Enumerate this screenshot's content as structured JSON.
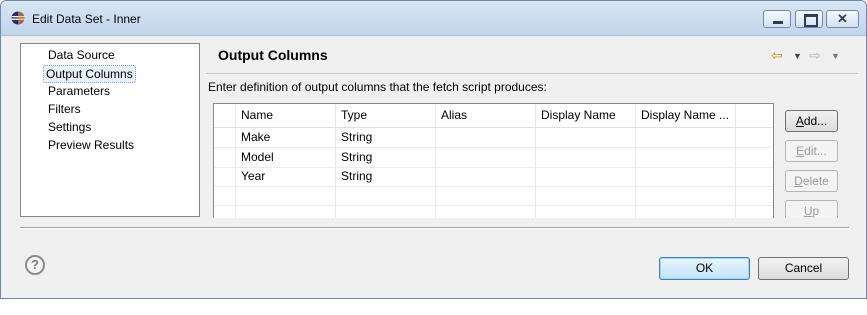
{
  "window": {
    "title": "Edit Data Set - Inner",
    "minimize_glyph": "",
    "close_glyph": "✕"
  },
  "nav": {
    "items": [
      {
        "label": "Data Source"
      },
      {
        "label": "Output Columns",
        "selected": true
      },
      {
        "label": "Parameters"
      },
      {
        "label": "Filters"
      },
      {
        "label": "Settings"
      },
      {
        "label": "Preview Results"
      }
    ]
  },
  "page": {
    "title": "Output Columns",
    "back_glyph": "⇦",
    "forward_glyph": "⇨",
    "dropdown_glyph": "▼",
    "instructions": "Enter definition of output columns that the fetch script produces:"
  },
  "table": {
    "columns": [
      "Name",
      "Type",
      "Alias",
      "Display Name",
      "Display Name ..."
    ],
    "rows": [
      [
        "Make",
        "String",
        "",
        "",
        ""
      ],
      [
        "Model",
        "String",
        "",
        "",
        ""
      ],
      [
        "Year",
        "String",
        "",
        "",
        ""
      ],
      [
        "",
        "",
        "",
        "",
        ""
      ],
      [
        "",
        "",
        "",
        "",
        ""
      ]
    ]
  },
  "side_buttons": {
    "add": {
      "prefix": "",
      "mnemonic": "A",
      "rest": "dd..."
    },
    "edit": {
      "prefix": "",
      "mnemonic": "E",
      "rest": "dit..."
    },
    "delete": {
      "prefix": "",
      "mnemonic": "D",
      "rest": "elete"
    },
    "up": {
      "prefix": "",
      "mnemonic": "U",
      "rest": "p"
    }
  },
  "footer": {
    "help_glyph": "?",
    "ok_label": "OK",
    "cancel_label": "Cancel"
  },
  "colors": {
    "titlebar": "#c2d5ec",
    "back_arrow": "#d08f1c",
    "ok_accent": "#3c7fb1"
  }
}
